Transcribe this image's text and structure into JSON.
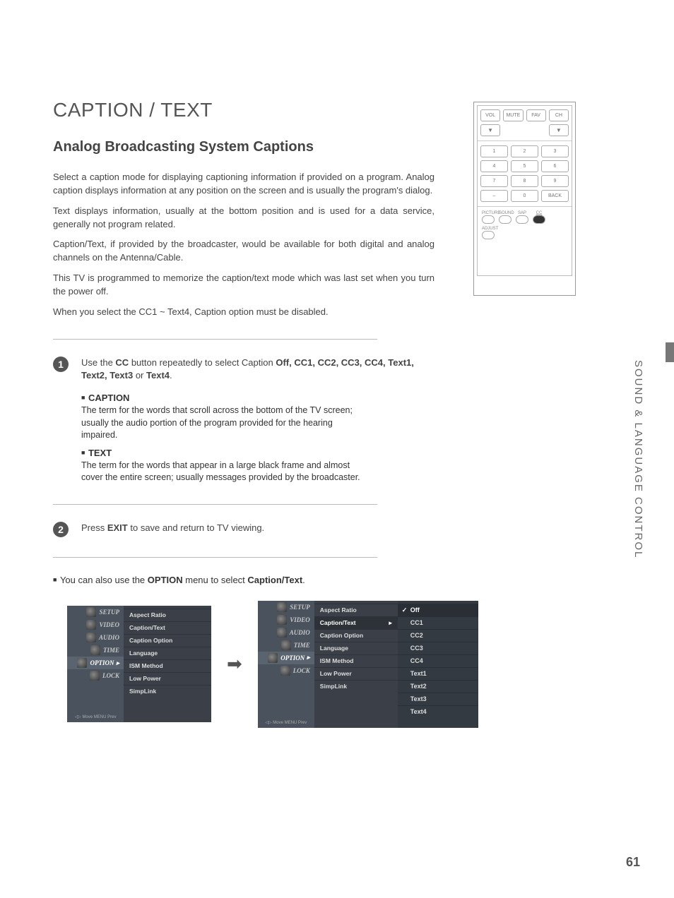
{
  "title": "CAPTION / TEXT",
  "subtitle": "Analog Broadcasting System Captions",
  "paragraphs": {
    "p1": "Select a caption mode for displaying captioning information if provided on a program. Analog caption displays information at any position on the screen and is usually the program's dialog.",
    "p2": "Text displays information, usually at the bottom position and is used for a data service, generally not program related.",
    "p3": "Caption/Text, if provided by the broadcaster, would be available for both digital and analog channels on the Antenna/Cable.",
    "p4": "This TV is programmed to memorize the caption/text mode which was last set when you turn the power off.",
    "p5": "When you select the CC1 ~ Text4, Caption option must be disabled."
  },
  "step1": {
    "num": "1",
    "pre": "Use the ",
    "cc": "CC",
    "mid": " button repeatedly to select Caption ",
    "opts": "Off, CC1, CC2, CC3, CC4, Text1, Text2, Text3",
    "or": " or ",
    "last": "Text4",
    "dot": "."
  },
  "caption_block": {
    "h": "CAPTION",
    "p": "The term for the words that scroll across the bottom of the TV screen; usually the audio portion of the program provided for the hearing impaired."
  },
  "text_block": {
    "h": "TEXT",
    "p": "The term for the words that appear in a large black frame and almost cover the entire screen; usually messages provided by the broadcaster."
  },
  "step2": {
    "num": "2",
    "pre": "Press ",
    "exit": "EXIT",
    "rest": " to save and return to TV viewing."
  },
  "note": {
    "pre": "You can also use the ",
    "option": "OPTION",
    "mid": " menu to select ",
    "ct": "Caption/Text",
    "dot": "."
  },
  "remote": {
    "vol": "VOL",
    "mute": "MUTE",
    "fav": "FAV",
    "ch": "CH",
    "keys": [
      "1",
      "2",
      "3",
      "4",
      "5",
      "6",
      "7",
      "8",
      "9",
      "–",
      "0",
      "BACK"
    ],
    "picture": "PICTURE",
    "sound": "SOUND",
    "sap": "SAP",
    "cc_label": "CC",
    "adjust": "ADJUST"
  },
  "osd": {
    "left_items": [
      "SETUP",
      "VIDEO",
      "AUDIO",
      "TIME",
      "OPTION",
      "LOCK"
    ],
    "footer_move": "Move",
    "footer_prev": "Prev",
    "options": [
      "Aspect Ratio",
      "Caption/Text",
      "Caption Option",
      "Language",
      "ISM Method",
      "Low Power",
      "SimpLink"
    ],
    "values": [
      "Off",
      "CC1",
      "CC2",
      "CC3",
      "CC4",
      "Text1",
      "Text2",
      "Text3",
      "Text4"
    ]
  },
  "side_section": "SOUND & LANGUAGE CONTROL",
  "page_number": "61"
}
